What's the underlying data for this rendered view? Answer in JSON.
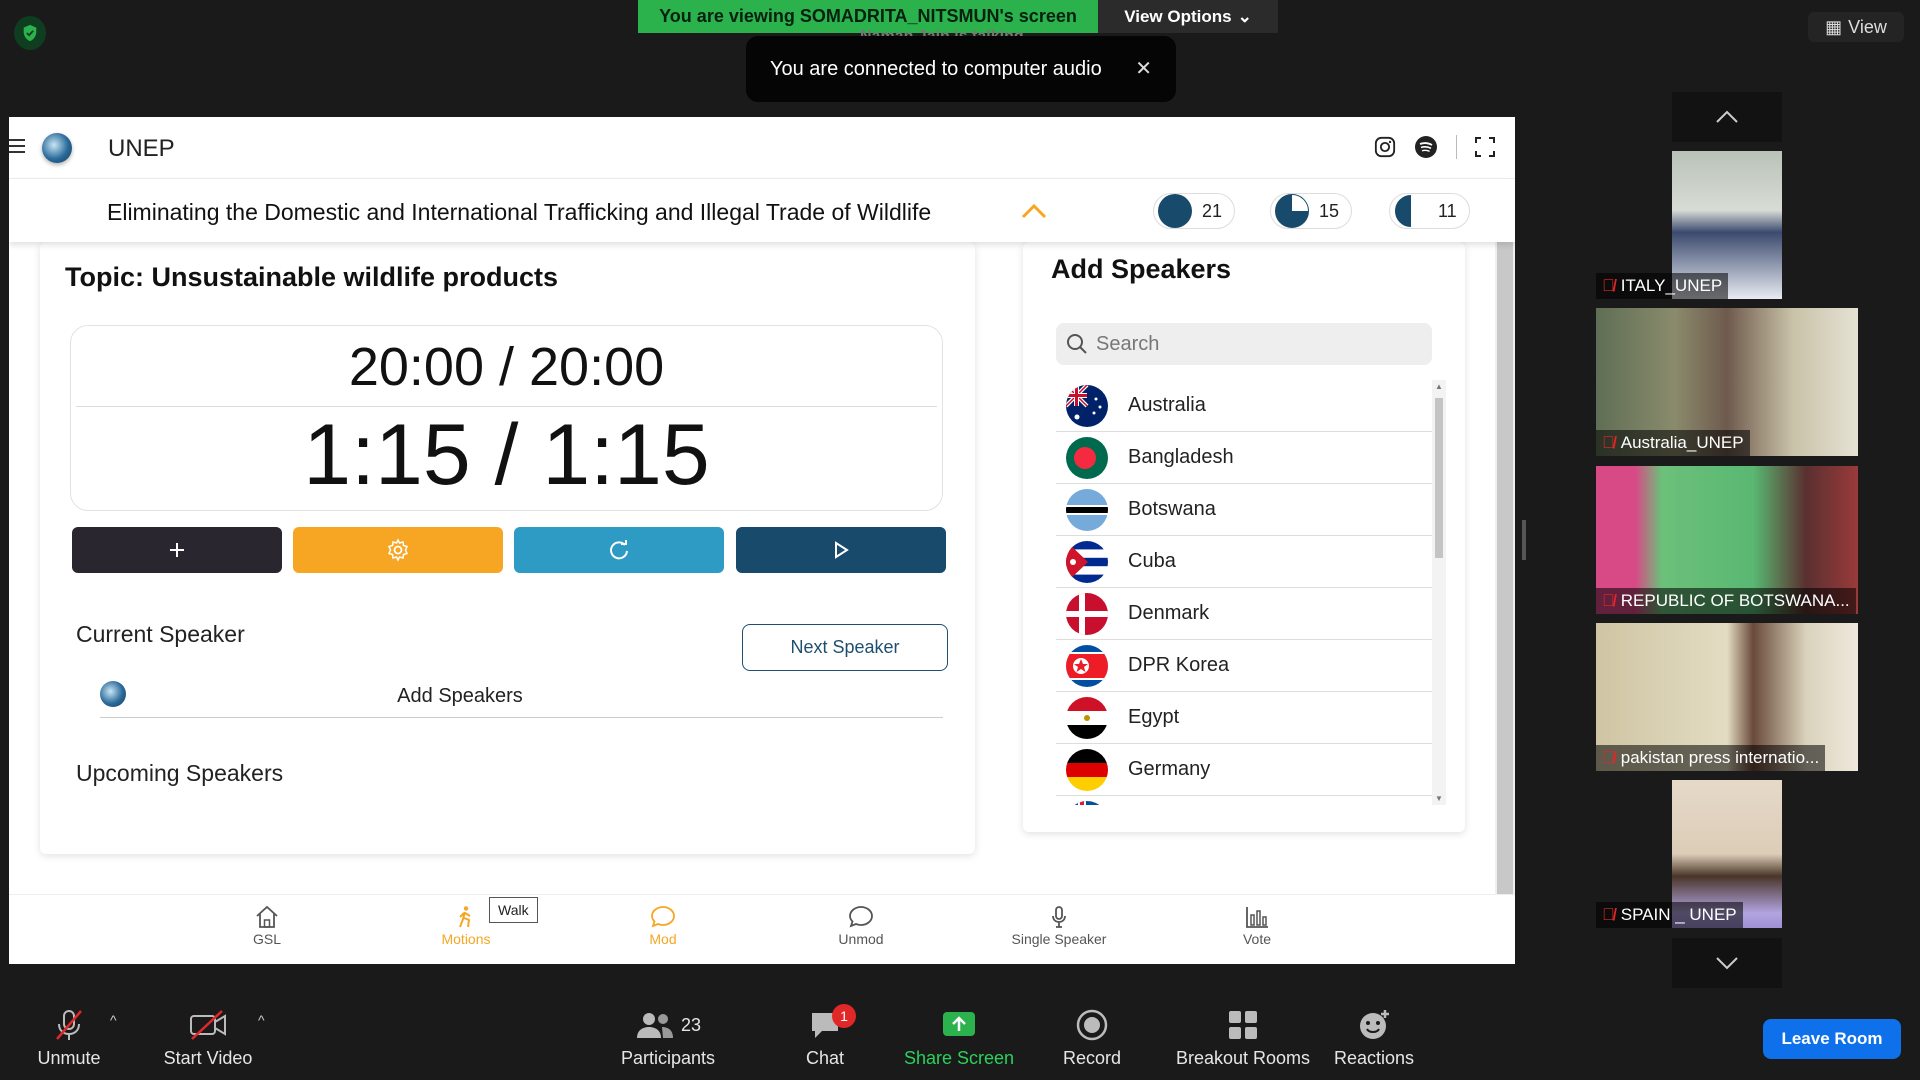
{
  "zoom": {
    "viewing_banner": "You are viewing SOMADRITA_NITSMUN's screen",
    "view_options": "View Options",
    "talking_indicator": "Naman Jain is talking...",
    "toast": "You are connected to computer audio",
    "top_view": "View",
    "toolbar": {
      "unmute": "Unmute",
      "start_video": "Start Video",
      "participants": "Participants",
      "participants_count": "23",
      "chat": "Chat",
      "chat_badge": "1",
      "share_screen": "Share Screen",
      "record": "Record",
      "breakout_rooms": "Breakout Rooms",
      "reactions": "Reactions",
      "leave_room": "Leave Room"
    },
    "colors": {
      "green": "#2bb24c",
      "blue": "#0e71eb",
      "red": "#e02828"
    }
  },
  "app": {
    "title": "UNEP",
    "agenda": "Eliminating the Domestic and International Trafficking and Illegal Trade of Wildlife",
    "stats": [
      "21",
      "15",
      "11"
    ],
    "topic": "Topic: Unsustainable wildlife products",
    "timer_total": "20:00 / 20:00",
    "timer_speaker": "1:15 / 1:15",
    "current_speaker_label": "Current Speaker",
    "next_speaker": "Next Speaker",
    "current_speaker_value": "Add Speakers",
    "upcoming_speakers_label": "Upcoming Speakers",
    "add_speakers_title": "Add Speakers",
    "search_placeholder": "Search",
    "countries": [
      "Australia",
      "Bangladesh",
      "Botswana",
      "Cuba",
      "Denmark",
      "DPR Korea",
      "Egypt",
      "Germany"
    ],
    "nav": {
      "gsl": "GSL",
      "motions": "Motions",
      "mod": "Mod",
      "unmod": "Unmod",
      "single_speaker": "Single Speaker",
      "vote": "Vote"
    },
    "tooltip": "Walk",
    "colors": {
      "dark": "#2a2630",
      "orange": "#f6a623",
      "teal": "#2d9bc4",
      "navy": "#184a6b"
    }
  },
  "participants": [
    {
      "name": "ITALY_UNEP"
    },
    {
      "name": "Australia_UNEP"
    },
    {
      "name": "REPUBLIC OF BOTSWANA..."
    },
    {
      "name": "pakistan press internatio..."
    },
    {
      "name": "SPAIN _ UNEP"
    }
  ]
}
